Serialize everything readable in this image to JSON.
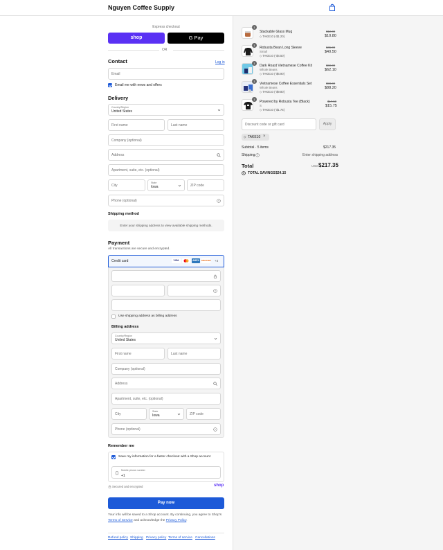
{
  "header": {
    "store_name": "Nguyen Coffee Supply"
  },
  "express": {
    "label": "Express checkout",
    "shop_label": "shop",
    "gpay_label": "G Pay",
    "or_label": "OR"
  },
  "contact": {
    "title": "Contact",
    "login_label": "Log in",
    "email_placeholder": "Email",
    "news_label": "Email me with news and offers"
  },
  "delivery": {
    "title": "Delivery",
    "country_label": "Country/Region",
    "country_value": "United States",
    "first_name": "First name",
    "last_name": "Last name",
    "company": "Company (optional)",
    "address": "Address",
    "apartment": "Apartment, suite, etc. (optional)",
    "city": "City",
    "state_label": "State",
    "state_value": "Iowa",
    "zip": "ZIP code",
    "phone": "Phone (optional)"
  },
  "shipping_method": {
    "title": "Shipping method",
    "message": "Enter your shipping address to view available shipping methods."
  },
  "payment": {
    "title": "Payment",
    "subtitle": "All transactions are secure and encrypted.",
    "method_label": "Credit card",
    "card_logos": [
      "VISA",
      "MC",
      "AMEX",
      "DISCOVER"
    ],
    "more_label": "+4",
    "same_address_label": "Use shipping address as billing address"
  },
  "billing": {
    "title": "Billing address",
    "country_label": "Country/Region",
    "country_value": "United States",
    "first_name": "First name",
    "last_name": "Last name",
    "company": "Company (optional)",
    "address": "Address",
    "apartment": "Apartment, suite, etc. (optional)",
    "city": "City",
    "state_label": "State",
    "state_value": "Iowa",
    "zip": "ZIP code",
    "phone": "Phone (optional)"
  },
  "remember": {
    "title": "Remember me",
    "save_label": "Save my information for a faster checkout with a Shop account",
    "mobile_label": "Mobile phone number",
    "mobile_value": "+1",
    "secure_label": "Secured and encrypted",
    "shop_label": "shop"
  },
  "pay_button": "Pay now",
  "legal": {
    "line1": "Your info will be saved to a Shop account. By continuing, you agree to Shop's",
    "terms": "Terms of Service",
    "and_text": "and acknowledge the",
    "privacy": "Privacy Policy",
    "period": "."
  },
  "footer_links": [
    "Refund policy",
    "Shipping",
    "Privacy policy",
    "Terms of service",
    "Cancellations"
  ],
  "cart": {
    "items": [
      {
        "qty": "1",
        "name": "Stackable Glass Mug",
        "variant": "",
        "discount": "TAKE10 (-$1.20)",
        "original": "$12.00",
        "price": "$10.80"
      },
      {
        "qty": "1",
        "name": "Robusta Bean Long Sleeve",
        "variant": "Small",
        "discount": "TAKE10 (-$4.50)",
        "original": "$45.00",
        "price": "$40.50"
      },
      {
        "qty": "1",
        "name": "Dark Roast Vietnamese Coffee Kit",
        "variant": "Whole Beans",
        "discount": "TAKE10 (-$6.90)",
        "original": "$69.00",
        "price": "$62.10"
      },
      {
        "qty": "1",
        "name": "Vietnamese Coffee Essentials Set",
        "variant": "Whole Beans",
        "discount": "TAKE10 (-$9.80)",
        "original": "$98.00",
        "price": "$88.20"
      },
      {
        "qty": "1",
        "name": "Powered by Robusta Tee (Black)",
        "variant": "S",
        "discount": "TAKE10 (-$1.75)",
        "original": "$17.50",
        "price": "$15.75"
      }
    ],
    "discount_placeholder": "Discount code or gift card",
    "apply_label": "Apply",
    "applied_code": "TAKE10",
    "subtotal_label": "Subtotal · 5 items",
    "subtotal_value": "$217.35",
    "shipping_label": "Shipping",
    "shipping_value": "Enter shipping address",
    "total_label": "Total",
    "currency": "USD",
    "total_value": "$217.35",
    "savings_label": "TOTAL SAVINGS",
    "savings_value": "$24.15"
  },
  "colors": {
    "accent": "#1d5ad8",
    "shop_purple": "#5a31f4"
  }
}
